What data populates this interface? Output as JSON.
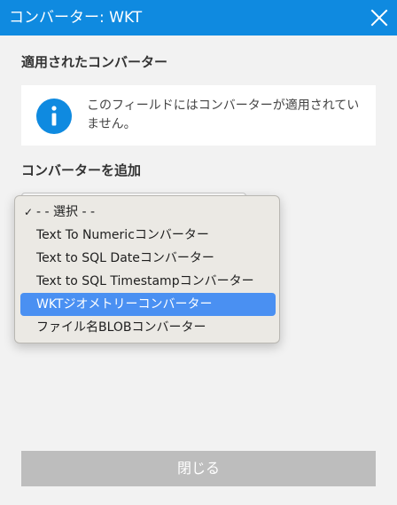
{
  "titlebar": {
    "title": "コンバーター: WKT",
    "close_icon": "close-icon"
  },
  "applied": {
    "heading": "適用されたコンバーター",
    "info_icon": "info-icon",
    "message": "このフィールドにはコンバーターが適用されていません。"
  },
  "add": {
    "heading": "コンバーターを追加",
    "options": [
      {
        "label": "- - 選択 - -",
        "checked": true,
        "highlighted": false
      },
      {
        "label": "Text To Numericコンバーター",
        "checked": false,
        "highlighted": false
      },
      {
        "label": "Text to SQL Dateコンバーター",
        "checked": false,
        "highlighted": false
      },
      {
        "label": "Text to SQL Timestampコンバーター",
        "checked": false,
        "highlighted": false
      },
      {
        "label": "WKTジオメトリーコンバーター",
        "checked": false,
        "highlighted": true
      },
      {
        "label": "ファイル名BLOBコンバーター",
        "checked": false,
        "highlighted": false
      }
    ],
    "check_mark": "✓"
  },
  "footer": {
    "close_label": "閉じる"
  },
  "colors": {
    "titlebar": "#0f8ae0",
    "info_icon": "#0f8ae0",
    "highlight": "#4a90f2",
    "close_button": "#bdbdbd"
  }
}
